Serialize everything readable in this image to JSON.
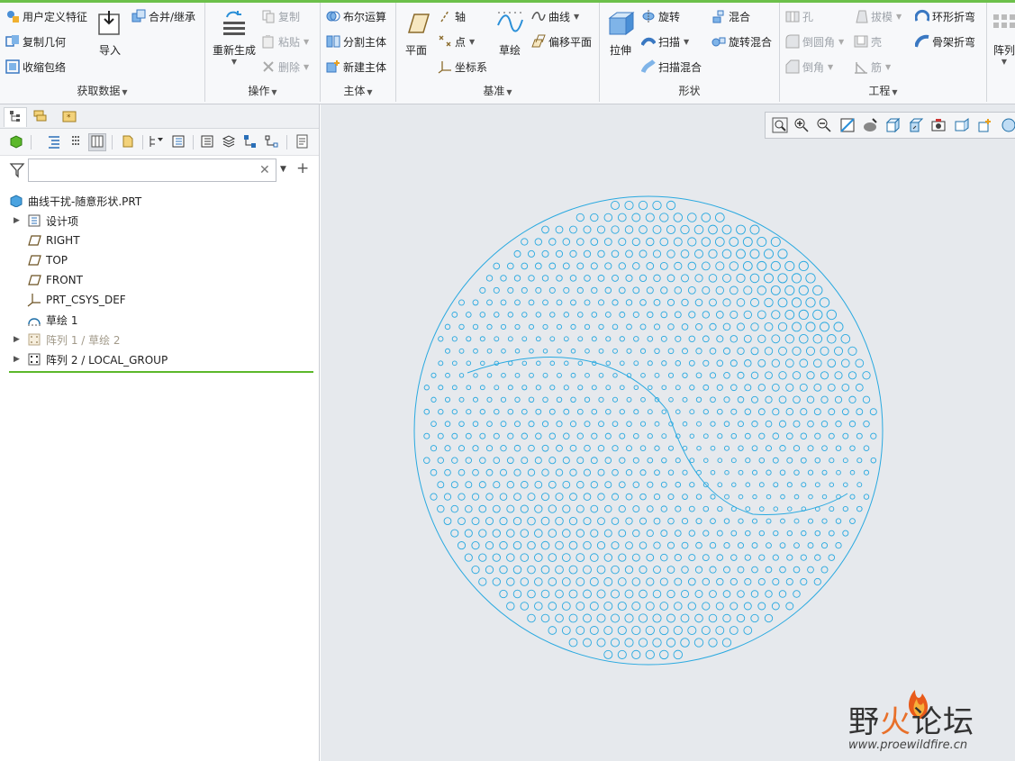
{
  "colors": {
    "accent": "#6cc04a",
    "sketch": "#29a9e0",
    "canvas_bg": "#e6e9ed",
    "insert_line": "#5cb82b"
  },
  "ribbon": {
    "get_data": {
      "label": "获取数据",
      "user_feature": "用户定义特征",
      "copy_geometry": "复制几何",
      "shrinkwrap": "收缩包络",
      "import": "导入",
      "merge_inherit": "合并/继承"
    },
    "operations": {
      "label": "操作",
      "regenerate": "重新生成",
      "copy": "复制",
      "paste": "粘贴",
      "delete": "删除"
    },
    "body": {
      "label": "主体",
      "boolean": "布尔运算",
      "split_body": "分割主体",
      "new_body": "新建主体"
    },
    "datum": {
      "label": "基准",
      "plane": "平面",
      "axis": "轴",
      "point": "点",
      "csys": "坐标系",
      "sketch": "草绘",
      "curve": "曲线",
      "offset_plane": "偏移平面"
    },
    "shapes": {
      "label": "形状",
      "extrude": "拉伸",
      "revolve": "旋转",
      "sweep": "扫描",
      "swept_blend": "扫描混合",
      "blend": "混合",
      "rotational_blend": "旋转混合"
    },
    "engineering": {
      "label": "工程",
      "hole": "孔",
      "round": "倒圆角",
      "chamfer": "倒角",
      "draft": "拔模",
      "shell": "壳",
      "rib": "筋",
      "toroidal_bend": "环形折弯",
      "spinal_bend": "骨架折弯"
    },
    "pattern": {
      "label": "阵列"
    }
  },
  "tree": {
    "search_placeholder": "",
    "root": "曲线干扰-随意形状.PRT",
    "items": [
      {
        "label": "设计项",
        "icon": "design-items-icon"
      },
      {
        "label": "RIGHT",
        "icon": "datum-plane-icon"
      },
      {
        "label": "TOP",
        "icon": "datum-plane-icon"
      },
      {
        "label": "FRONT",
        "icon": "datum-plane-icon"
      },
      {
        "label": "PRT_CSYS_DEF",
        "icon": "csys-icon"
      },
      {
        "label": "草绘 1",
        "icon": "sketch-icon"
      },
      {
        "label": "阵列 1 / 草绘 2",
        "icon": "pattern-icon"
      },
      {
        "label": "阵列 2 / LOCAL_GROUP",
        "icon": "pattern-icon"
      }
    ]
  },
  "watermark": {
    "title_a": "野",
    "title_b": "火",
    "title_c": "论坛",
    "url": "www.proewildfire.cn"
  }
}
